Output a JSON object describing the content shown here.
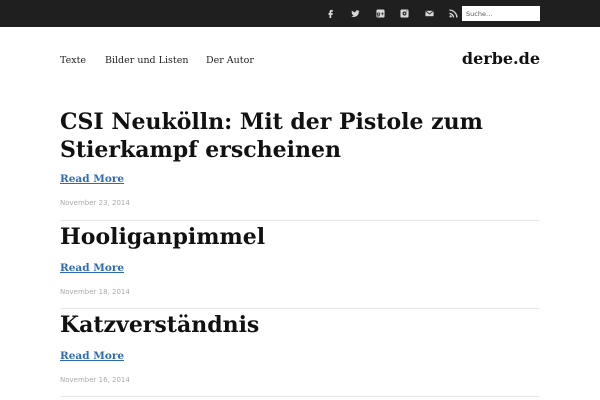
{
  "topbar": {
    "icons": [
      "facebook-icon",
      "twitter-icon",
      "google-plus-icon",
      "instagram-icon",
      "mail-icon",
      "rss-icon"
    ],
    "search_placeholder": "Suche…"
  },
  "nav": {
    "items": [
      "Texte",
      "Bilder und Listen",
      "Der Autor"
    ],
    "brand": "derbe.de"
  },
  "posts": [
    {
      "title": "CSI Neukölln: Mit der Pistole zum Stierkampf erscheinen",
      "read_more": "Read More",
      "date": "November 23, 2014"
    },
    {
      "title": "Hooliganpimmel",
      "read_more": "Read More",
      "date": "November 18, 2014"
    },
    {
      "title": "Katzverständnis",
      "read_more": "Read More",
      "date": "November 16, 2014"
    }
  ],
  "colors": {
    "topbar": "#1f1f1f",
    "link": "#2f6bb0",
    "date": "#aaaaaa"
  }
}
